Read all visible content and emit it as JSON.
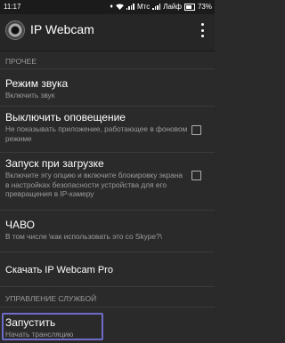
{
  "status_bar": {
    "time": "11:17",
    "carrier_1": "Mтс",
    "carrier_2": "Лайф",
    "battery": "73%"
  },
  "app_bar": {
    "title": "IP Webcam",
    "logo_icon": "ip-webcam-logo-icon",
    "menu_icon": "overflow-menu-icon"
  },
  "sections": {
    "other": {
      "header": "ПРОЧЕЕ"
    },
    "service": {
      "header": "УПРАВЛЕНИЕ СЛУЖБОЙ"
    }
  },
  "items": {
    "sound_mode": {
      "title": "Режим звука",
      "subtitle": "Включить звук"
    },
    "disable_notification": {
      "title": "Выключить оповещение",
      "subtitle": "Не показывать приложение, работающее в фоновом режиме",
      "checked": false
    },
    "run_on_boot": {
      "title": "Запуск при загрузке",
      "subtitle": "Включите эту опцию и включите блокировку экрана в настройках безопасности устройства для его превращения в IP-камеру",
      "checked": false
    },
    "faq": {
      "title": "ЧАВО",
      "subtitle": "В том числе \\как использовать это со Skype?\\"
    },
    "download_pro": {
      "title": "Скачать IP Webcam Pro"
    },
    "start": {
      "title": "Запустить",
      "subtitle": "Начать трансляцию"
    }
  },
  "colors": {
    "background": "#2a2a2a",
    "app_bar": "#262626",
    "highlight": "#6f6cc9"
  }
}
